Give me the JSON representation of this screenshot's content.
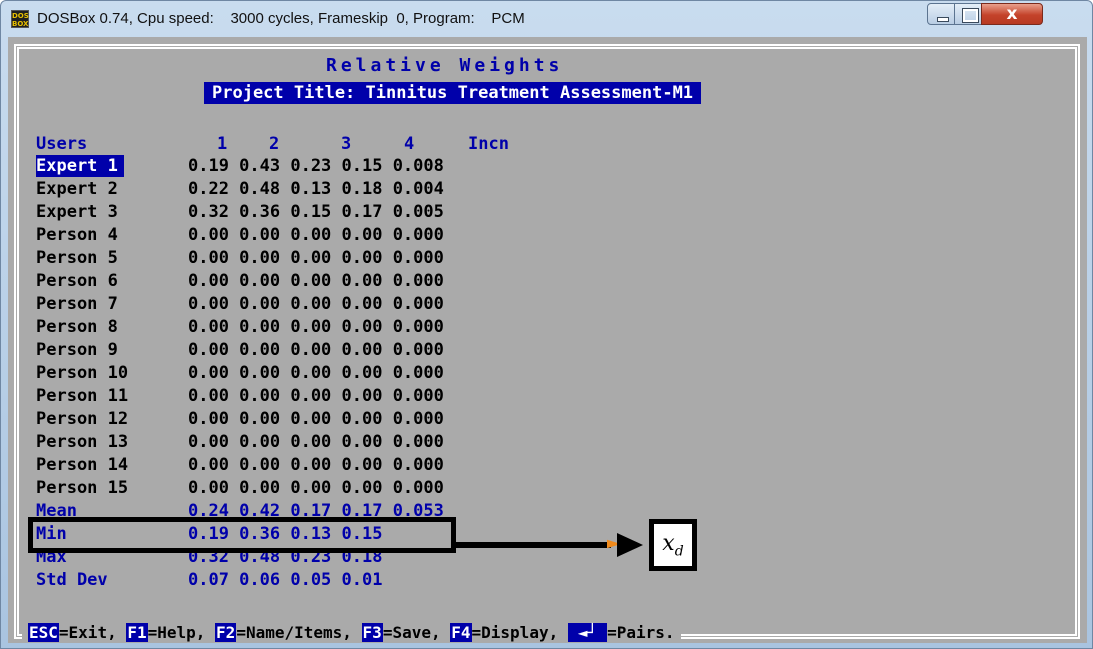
{
  "window": {
    "title": "DOSBox 0.74, Cpu speed:    3000 cycles, Frameskip  0, Program:    PCM",
    "icon_label": "DOS BOX",
    "close_label": "x"
  },
  "screen": {
    "frame_title": "Relative Weights",
    "project_title": "Project Title: Tinnitus Treatment Assessment-M1",
    "header": {
      "users": "Users",
      "cols": [
        "1",
        "2",
        "3",
        "4",
        "Incn"
      ]
    },
    "rows": [
      {
        "name": "Expert 1",
        "vals": "0.19 0.43 0.23 0.15 0.008"
      },
      {
        "name": "Expert 2",
        "vals": "0.22 0.48 0.13 0.18 0.004"
      },
      {
        "name": "Expert 3",
        "vals": "0.32 0.36 0.15 0.17 0.005"
      },
      {
        "name": "Person 4",
        "vals": "0.00 0.00 0.00 0.00 0.000"
      },
      {
        "name": "Person 5",
        "vals": "0.00 0.00 0.00 0.00 0.000"
      },
      {
        "name": "Person 6",
        "vals": "0.00 0.00 0.00 0.00 0.000"
      },
      {
        "name": "Person 7",
        "vals": "0.00 0.00 0.00 0.00 0.000"
      },
      {
        "name": "Person 8",
        "vals": "0.00 0.00 0.00 0.00 0.000"
      },
      {
        "name": "Person 9",
        "vals": "0.00 0.00 0.00 0.00 0.000"
      },
      {
        "name": "Person 10",
        "vals": "0.00 0.00 0.00 0.00 0.000"
      },
      {
        "name": "Person 11",
        "vals": "0.00 0.00 0.00 0.00 0.000"
      },
      {
        "name": "Person 12",
        "vals": "0.00 0.00 0.00 0.00 0.000"
      },
      {
        "name": "Person 13",
        "vals": "0.00 0.00 0.00 0.00 0.000"
      },
      {
        "name": "Person 14",
        "vals": "0.00 0.00 0.00 0.00 0.000"
      },
      {
        "name": "Person 15",
        "vals": "0.00 0.00 0.00 0.00 0.000"
      }
    ],
    "stats": [
      {
        "name": "Mean",
        "vals": "0.24 0.42 0.17 0.17 0.053"
      },
      {
        "name": "Min",
        "vals": "0.19 0.36 0.13 0.15"
      },
      {
        "name": "Max",
        "vals": "0.32 0.48 0.23 0.18"
      },
      {
        "name": "Std Dev",
        "vals": "0.07 0.06 0.05 0.01"
      }
    ],
    "selected_row": "Expert 1"
  },
  "fkeys": {
    "esc_key": "ESC",
    "esc_label": "=Exit, ",
    "f1_key": "F1",
    "f1_label": "=Help, ",
    "f2_key": "F2",
    "f2_label": "=Name/Items, ",
    "f3_key": "F3",
    "f3_label": "=Save, ",
    "f4_key": "F4",
    "f4_label": "=Display, ",
    "enter_key": "◄┘",
    "enter_label": "=Pairs."
  },
  "annotation": {
    "label_base": "x",
    "label_sub": "d"
  },
  "colors": {
    "dos_background": "#aaaaaa",
    "dos_blue": "#0000aa",
    "annotation_arrow_tip": "#f08a1c"
  }
}
